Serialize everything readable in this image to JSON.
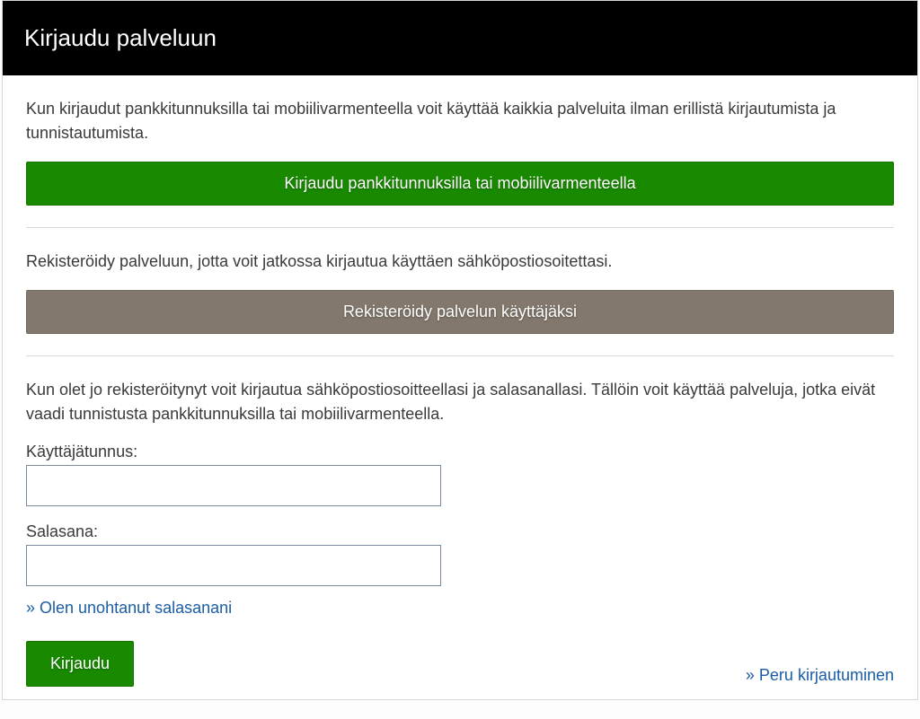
{
  "header": {
    "title": "Kirjaudu palveluun"
  },
  "section1": {
    "text": "Kun kirjaudut pankkitunnuksilla tai mobiilivarmenteella voit käyttää kaikkia palveluita ilman erillistä kirjautumista ja tunnistautumista.",
    "button": "Kirjaudu pankkitunnuksilla tai mobiilivarmenteella"
  },
  "section2": {
    "text": "Rekisteröidy palveluun, jotta voit jatkossa kirjautua käyttäen sähköpostiosoitettasi.",
    "button": "Rekisteröidy palvelun käyttäjäksi"
  },
  "section3": {
    "text": "Kun olet jo rekisteröitynyt voit kirjautua sähköpostiosoitteellasi ja salasanallasi. Tällöin voit käyttää palveluja, jotka eivät vaadi tunnistusta pankkitunnuksilla tai mobiilivarmenteella."
  },
  "form": {
    "username_label": "Käyttäjätunnus:",
    "password_label": "Salasana:",
    "forgot_link": "» Olen unohtanut salasanani",
    "submit": "Kirjaudu",
    "cancel": "» Peru kirjautuminen"
  }
}
